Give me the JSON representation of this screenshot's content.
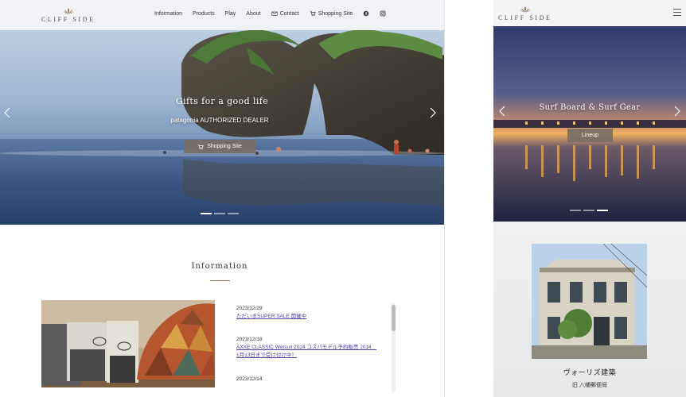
{
  "brand": {
    "logo_text": "CLIFF SIDE"
  },
  "desktop": {
    "nav": [
      {
        "label": "Information",
        "icon": ""
      },
      {
        "label": "Products",
        "icon": ""
      },
      {
        "label": "Play",
        "icon": ""
      },
      {
        "label": "About",
        "icon": ""
      },
      {
        "label": "Contact",
        "icon": "mail-icon"
      },
      {
        "label": "Shopping Site",
        "icon": "cart-icon"
      }
    ],
    "social": [
      "facebook-icon",
      "instagram-icon"
    ],
    "hero": {
      "title": "Gifts for a good life",
      "subtitle": "patagonia AUTHORIZED DEALER",
      "button_label": "Shopping Site",
      "slides": 3,
      "active_slide": 1
    },
    "information": {
      "heading": "Information",
      "news": [
        {
          "date": "2023/12/29",
          "title": "ただいまSUPER SALE 開催中"
        },
        {
          "date": "2023/12/18",
          "title": "AXXE CLASSIC Wetsuit 2024 コスパモデル予約販売 2014　1月13日まで受け付け中！"
        },
        {
          "date": "2023/12/14",
          "title": ""
        }
      ]
    }
  },
  "mobile": {
    "hero": {
      "title": "Surf Board & Surf Gear",
      "button_label": "Lineup",
      "slides": 3,
      "active_slide": 3
    },
    "feature": {
      "title": "ヴォーリズ建築",
      "subtitle": "旧 八幡郵便局"
    }
  },
  "colors": {
    "accent": "#8b6f52",
    "button": "#786e64",
    "link": "#4a3ea8"
  }
}
